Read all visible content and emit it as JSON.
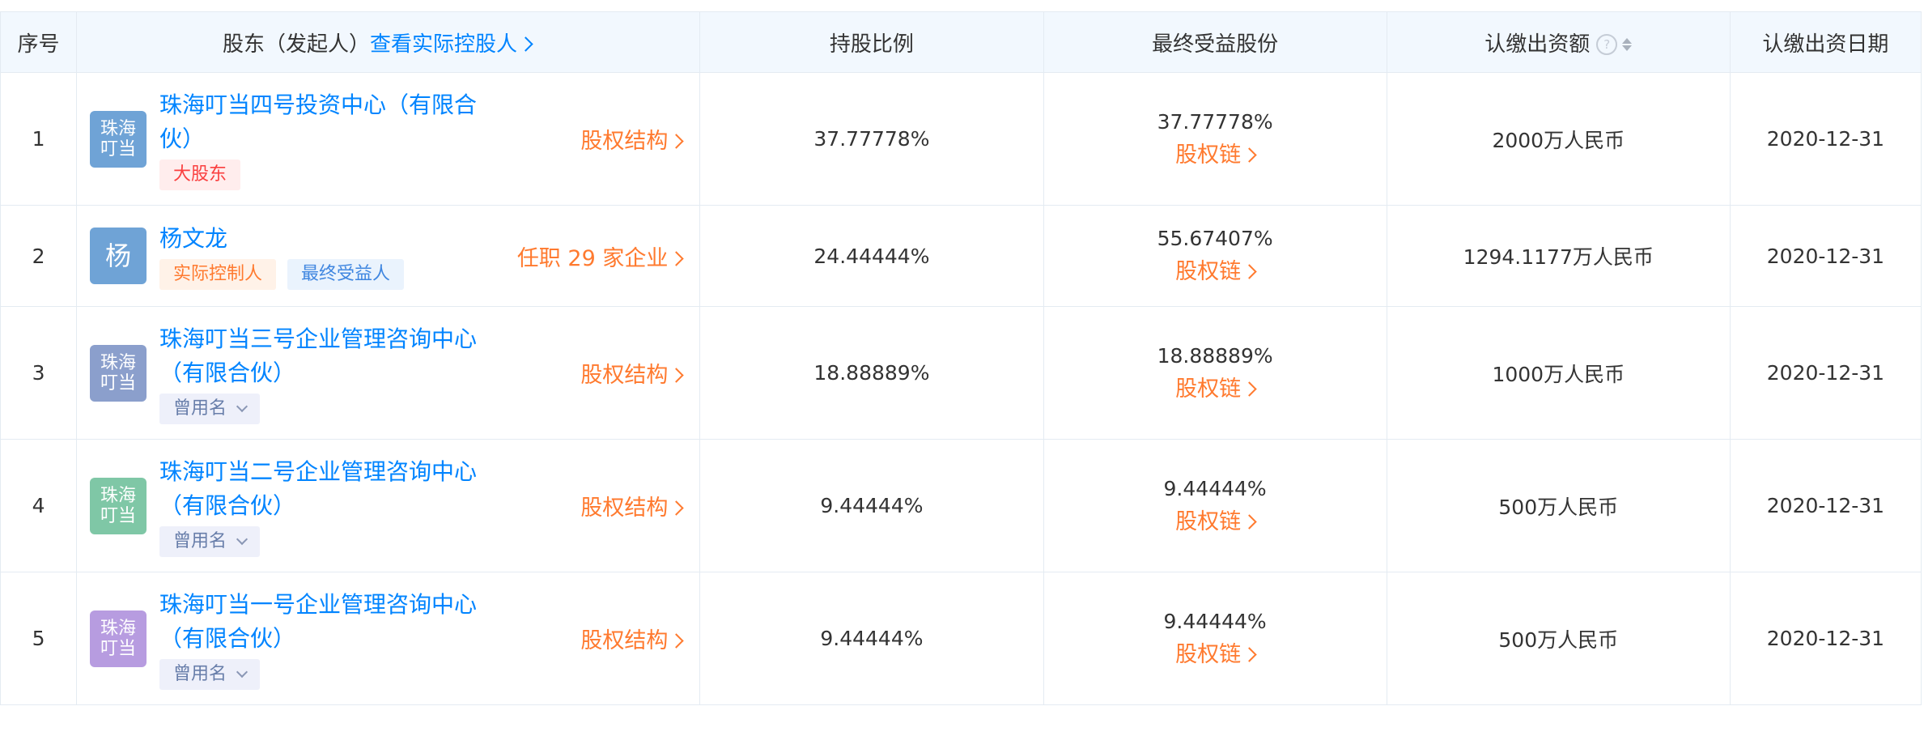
{
  "header": {
    "index": "序号",
    "holder": "股东（发起人）",
    "holder_link": "查看实际控股人",
    "ratio": "持股比例",
    "final_shares": "最终受益股份",
    "capital": "认缴出资额",
    "capital_help": "?",
    "date": "认缴出资日期"
  },
  "colors": {
    "link_blue": "#0084ff",
    "orange": "#ff7a2f",
    "header_bg": "#f2f8fe",
    "border": "#e4ebf2"
  },
  "rows": [
    {
      "index": "1",
      "avatar": "珠海叮当",
      "avatar_color": "#6fa3d6",
      "name": "珠海叮当四号投资中心（有限合伙）",
      "tags": [
        "大股东"
      ],
      "right_link": "股权结构",
      "ratio": "37.77778%",
      "final_share": "37.77778%",
      "chain_link": "股权链",
      "capital": "2000万人民币",
      "date": "2020-12-31"
    },
    {
      "index": "2",
      "avatar": "杨",
      "avatar_color": "#6fa3d6",
      "name": "杨文龙",
      "tags": [
        "实际控制人",
        "最终受益人"
      ],
      "right_link": "任职 29 家企业",
      "ratio": "24.44444%",
      "final_share": "55.67407%",
      "chain_link": "股权链",
      "capital": "1294.1177万人民币",
      "date": "2020-12-31"
    },
    {
      "index": "3",
      "avatar": "珠海叮当",
      "avatar_color": "#8b9fcc",
      "name": "珠海叮当三号企业管理咨询中心（有限合伙）",
      "tags": [
        "曾用名"
      ],
      "right_link": "股权结构",
      "ratio": "18.88889%",
      "final_share": "18.88889%",
      "chain_link": "股权链",
      "capital": "1000万人民币",
      "date": "2020-12-31"
    },
    {
      "index": "4",
      "avatar": "珠海叮当",
      "avatar_color": "#7fc7a6",
      "name": "珠海叮当二号企业管理咨询中心（有限合伙）",
      "tags": [
        "曾用名"
      ],
      "right_link": "股权结构",
      "ratio": "9.44444%",
      "final_share": "9.44444%",
      "chain_link": "股权链",
      "capital": "500万人民币",
      "date": "2020-12-31"
    },
    {
      "index": "5",
      "avatar": "珠海叮当",
      "avatar_color": "#b79ce0",
      "name": "珠海叮当一号企业管理咨询中心（有限合伙）",
      "tags": [
        "曾用名"
      ],
      "right_link": "股权结构",
      "ratio": "9.44444%",
      "final_share": "9.44444%",
      "chain_link": "股权链",
      "capital": "500万人民币",
      "date": "2020-12-31"
    }
  ]
}
